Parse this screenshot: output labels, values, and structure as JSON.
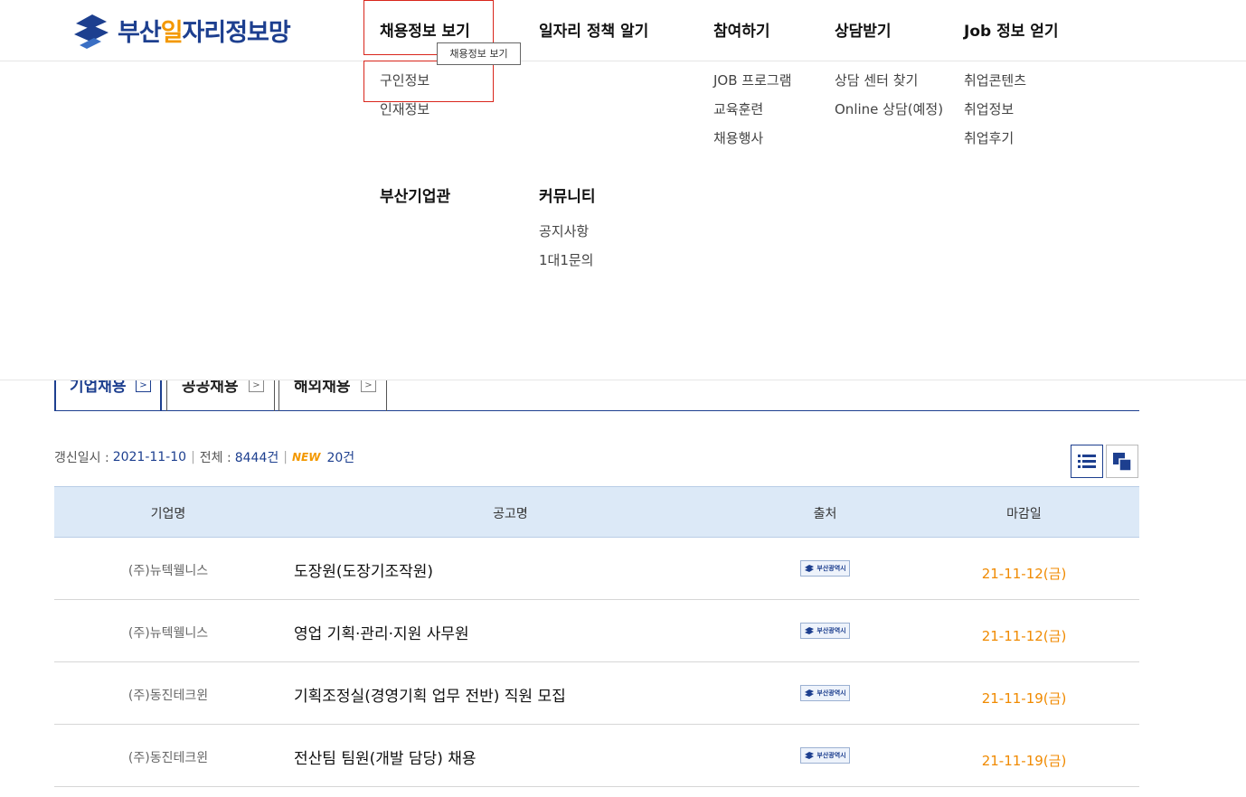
{
  "logo": {
    "text_main": "부산",
    "text_accent": "일",
    "text_rest": "자리정보망"
  },
  "gnb": [
    {
      "label": "채용정보 보기"
    },
    {
      "label": "일자리 정책 알기"
    },
    {
      "label": "참여하기"
    },
    {
      "label": "상담받기"
    },
    {
      "label": "Job 정보 얻기"
    }
  ],
  "tooltip": "채용정보 보기",
  "menu": {
    "col1": [
      "구인정보",
      "인재정보"
    ],
    "col3": [
      "JOB 프로그램",
      "교육훈련",
      "채용행사"
    ],
    "col4": [
      "상담 센터 찾기",
      "Online 상담(예정)"
    ],
    "col5": [
      "취업콘텐츠",
      "취업정보",
      "취업후기"
    ],
    "group2_head1": "부산기업관",
    "group2_head2": "커뮤니티",
    "community": [
      "공지사항",
      "1대1문의"
    ]
  },
  "tabs": [
    {
      "label": "기업채용"
    },
    {
      "label": "공공채용"
    },
    {
      "label": "해외채용"
    }
  ],
  "meta": {
    "updated_label": "갱신일시 :",
    "updated_value": "2021-11-10",
    "total_label": "전체 :",
    "total_value": "8444건",
    "new_badge": "NEW",
    "new_count": "20건"
  },
  "table": {
    "headers": [
      "기업명",
      "공고명",
      "출처",
      "마감일"
    ],
    "source_label": "부산광역시",
    "rows": [
      {
        "company": "(주)뉴텍웰니스",
        "title": "도장원(도장기조작원)",
        "deadline": "21-11-12(금)"
      },
      {
        "company": "(주)뉴텍웰니스",
        "title": "영업 기획·관리·지원 사무원",
        "deadline": "21-11-12(금)"
      },
      {
        "company": "(주)동진테크윈",
        "title": "기획조정실(경영기획 업무 전반) 직원 모집",
        "deadline": "21-11-19(금)"
      },
      {
        "company": "(주)동진테크윈",
        "title": "전산팀 팀원(개발 담당) 채용",
        "deadline": "21-11-19(금)"
      }
    ]
  },
  "colors": {
    "brand_blue": "#1d3f8f",
    "accent_orange": "#f39800",
    "highlight_red": "#d9261c"
  }
}
